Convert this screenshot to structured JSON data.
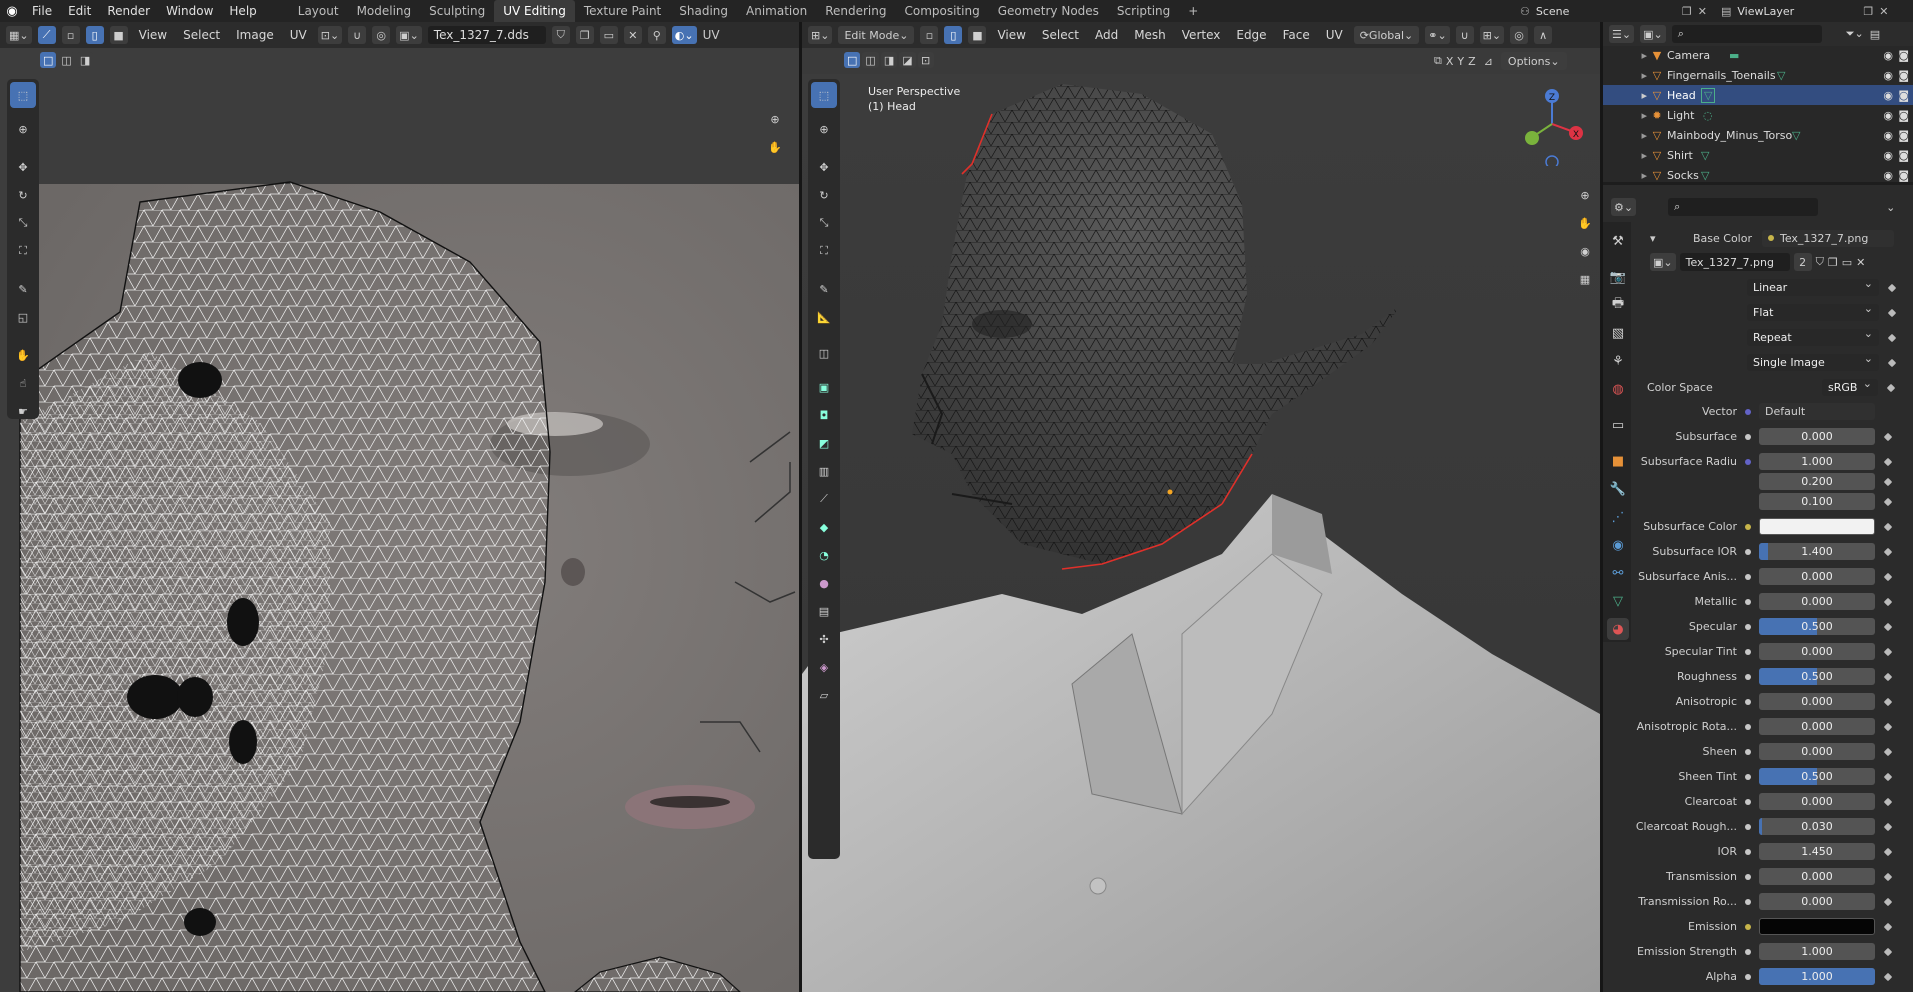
{
  "app": {
    "menus": [
      "File",
      "Edit",
      "Render",
      "Window",
      "Help"
    ],
    "workspaces": [
      "Layout",
      "Modeling",
      "Sculpting",
      "UV Editing",
      "Texture Paint",
      "Shading",
      "Animation",
      "Rendering",
      "Compositing",
      "Geometry Nodes",
      "Scripting"
    ],
    "active_workspace": "UV Editing",
    "add_tab": "+",
    "scene": "Scene",
    "view_layer": "ViewLayer"
  },
  "uv_editor": {
    "menus": [
      "View",
      "Select",
      "Image",
      "UV"
    ],
    "image_name": "Tex_1327_7.dds",
    "overflow_label": "UV"
  },
  "viewport": {
    "mode": "Edit Mode",
    "menus": [
      "View",
      "Select",
      "Add",
      "Mesh",
      "Vertex",
      "Edge",
      "Face",
      "UV"
    ],
    "orientation": "Global",
    "axes": [
      "X",
      "Y",
      "Z"
    ],
    "options_label": "Options",
    "overlay_line1": "User Perspective",
    "overlay_line2": "(1) Head"
  },
  "outliner": {
    "items": [
      {
        "name": "Camera",
        "type": "camera",
        "selected": false
      },
      {
        "name": "Fingernails_Toenails",
        "type": "mesh",
        "selected": false
      },
      {
        "name": "Head",
        "type": "mesh",
        "selected": true
      },
      {
        "name": "Light",
        "type": "light",
        "selected": false
      },
      {
        "name": "Mainbody_Minus_Torso",
        "type": "mesh",
        "selected": false
      },
      {
        "name": "Shirt",
        "type": "mesh",
        "selected": false
      },
      {
        "name": "Socks",
        "type": "mesh",
        "selected": false
      }
    ]
  },
  "properties": {
    "base_color_label": "Base Color",
    "base_color_value": "Tex_1327_7.png",
    "image_name": "Tex_1327_7.png",
    "image_users": "2",
    "dropdowns": [
      "Linear",
      "Flat",
      "Repeat",
      "Single Image"
    ],
    "color_space_label": "Color Space",
    "color_space_value": "sRGB",
    "vector_label": "Vector",
    "vector_value": "Default",
    "fields": [
      {
        "label": "Subsurface",
        "value": "0.000",
        "fill": 0
      },
      {
        "label": "Subsurface Radiu",
        "value": "1.000",
        "fill": 0
      },
      {
        "label": "",
        "value": "0.200",
        "fill": 0
      },
      {
        "label": "",
        "value": "0.100",
        "fill": 0
      },
      {
        "label": "Subsurface Color",
        "value": "",
        "fill": 0,
        "color": "#f2f2f2"
      },
      {
        "label": "Subsurface IOR",
        "value": "1.400",
        "fill": 0.08
      },
      {
        "label": "Subsurface Anis...",
        "value": "0.000",
        "fill": 0
      },
      {
        "label": "Metallic",
        "value": "0.000",
        "fill": 0
      },
      {
        "label": "Specular",
        "value": "0.500",
        "fill": 0.5
      },
      {
        "label": "Specular Tint",
        "value": "0.000",
        "fill": 0
      },
      {
        "label": "Roughness",
        "value": "0.500",
        "fill": 0.5
      },
      {
        "label": "Anisotropic",
        "value": "0.000",
        "fill": 0
      },
      {
        "label": "Anisotropic Rota...",
        "value": "0.000",
        "fill": 0
      },
      {
        "label": "Sheen",
        "value": "0.000",
        "fill": 0
      },
      {
        "label": "Sheen Tint",
        "value": "0.500",
        "fill": 0.5
      },
      {
        "label": "Clearcoat",
        "value": "0.000",
        "fill": 0
      },
      {
        "label": "Clearcoat Rough...",
        "value": "0.030",
        "fill": 0.03
      },
      {
        "label": "IOR",
        "value": "1.450",
        "fill": 0
      },
      {
        "label": "Transmission",
        "value": "0.000",
        "fill": 0
      },
      {
        "label": "Transmission Ro...",
        "value": "0.000",
        "fill": 0
      },
      {
        "label": "Emission",
        "value": "",
        "fill": 0,
        "color": "#050505"
      },
      {
        "label": "Emission Strength",
        "value": "1.000",
        "fill": 0
      },
      {
        "label": "Alpha",
        "value": "1.000",
        "fill": 1
      }
    ]
  },
  "colors": {
    "accent": "#4772b3",
    "selected_row": "#334d80",
    "background": "#1d1d1d",
    "edge_highlight": "#e0302a"
  }
}
